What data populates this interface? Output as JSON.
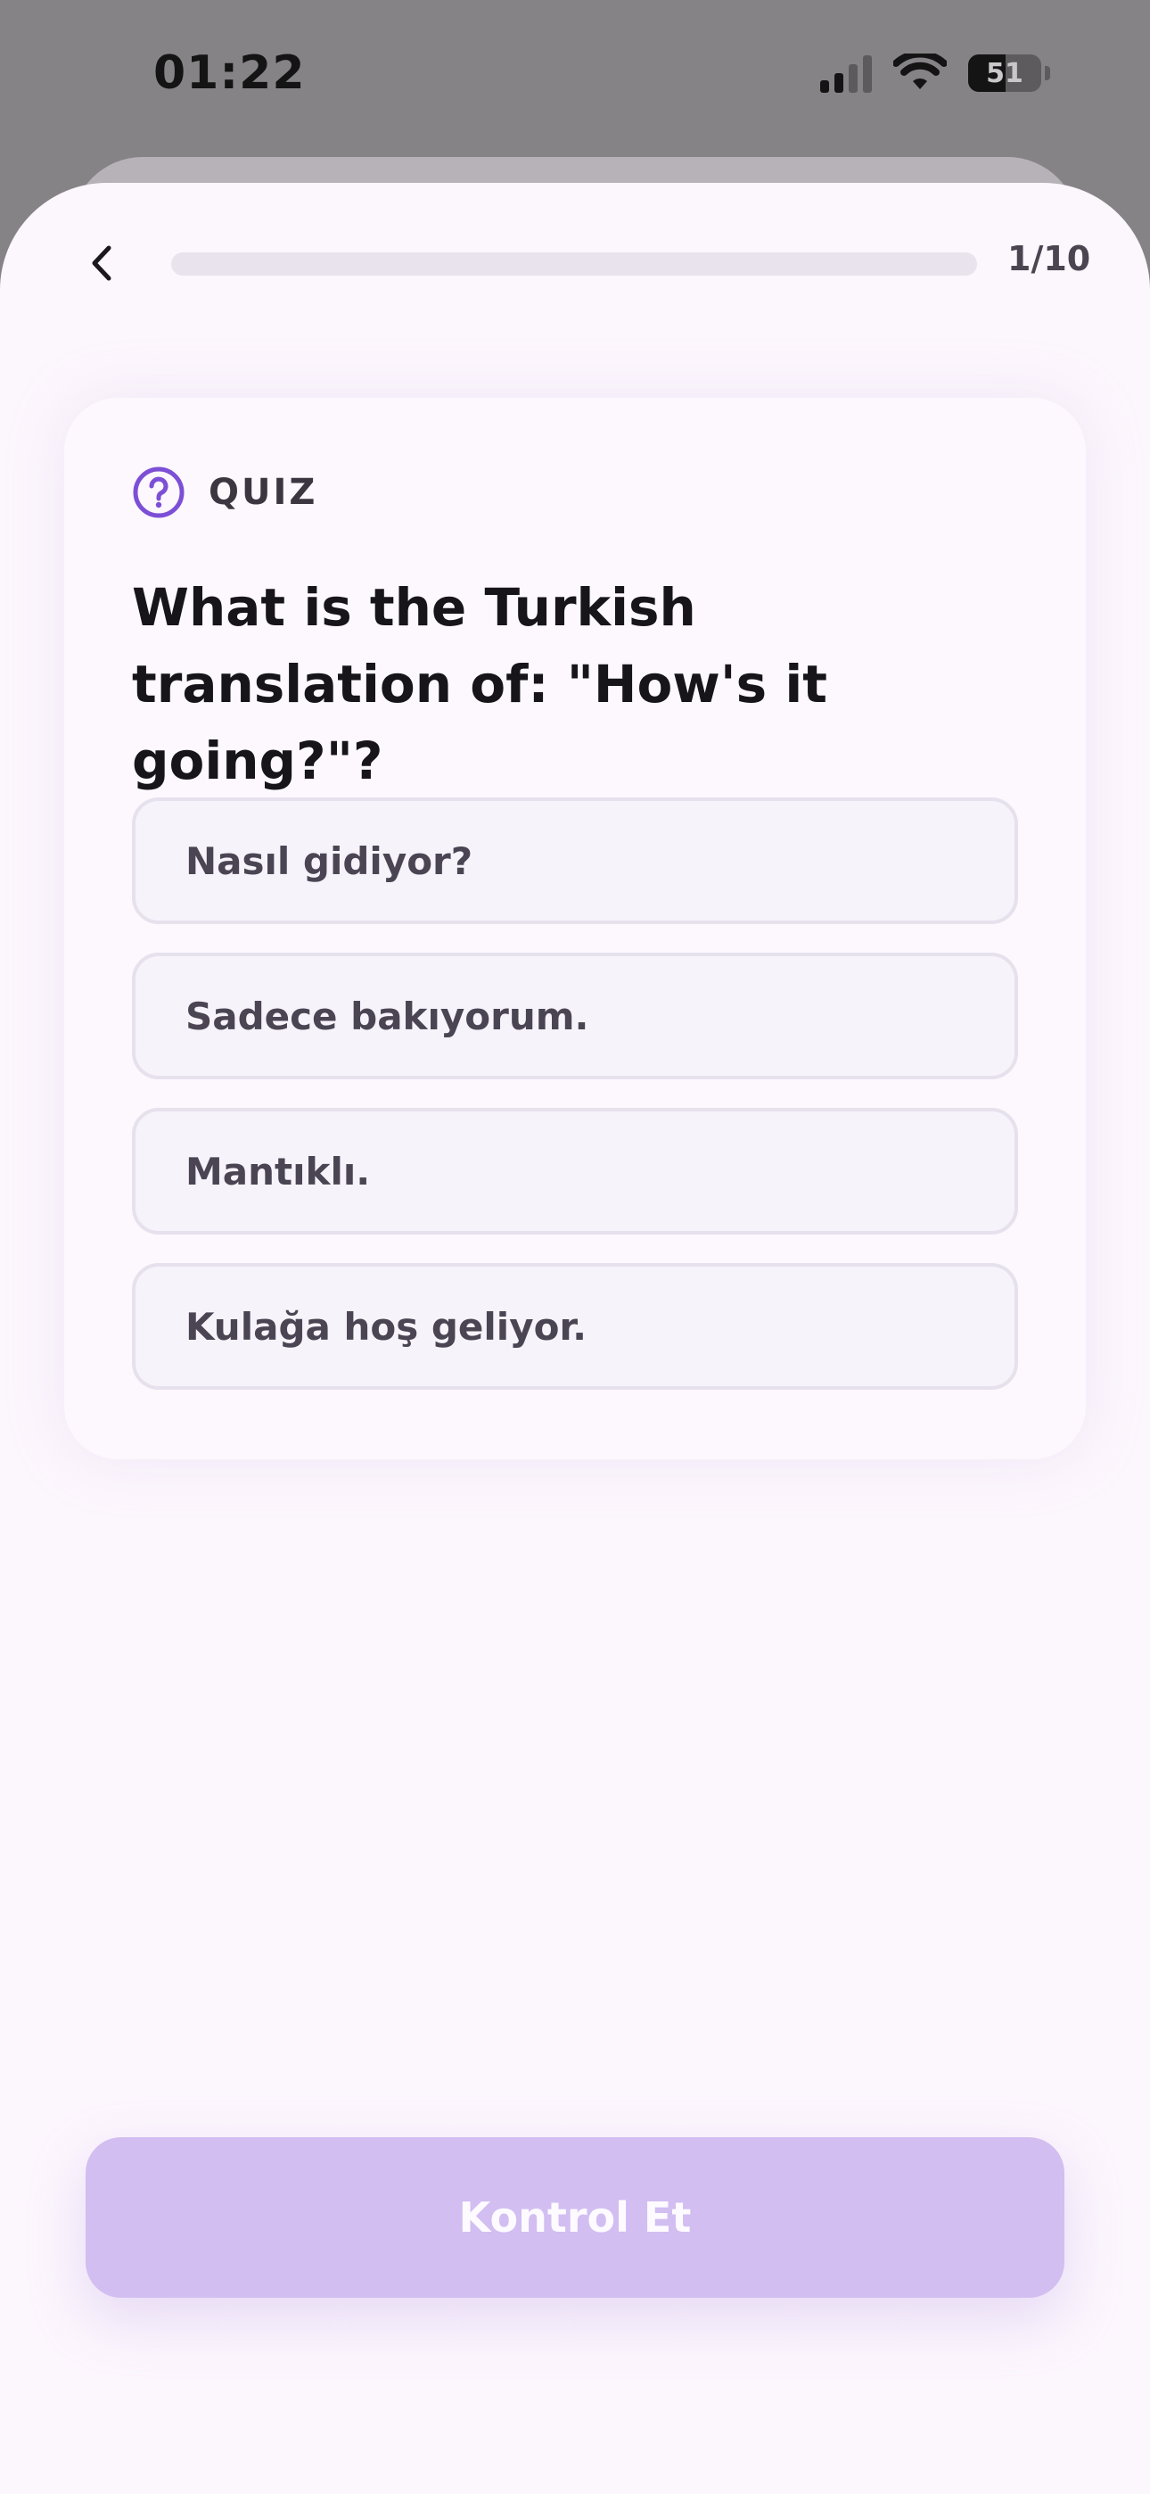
{
  "status_bar": {
    "time": "01:22",
    "battery": "51",
    "battery_level": 0.51
  },
  "nav": {
    "progress_text": "1/10",
    "progress_fraction": 0.0
  },
  "quiz": {
    "label": "QUIZ",
    "question": "What is the Turkish translation of: \"How's it going?\"?",
    "options": [
      "Nasıl gidiyor?",
      "Sadece bakıyorum.",
      "Mantıklı.",
      "Kulağa hoş geliyor."
    ]
  },
  "footer": {
    "check_label": "Kontrol Et"
  },
  "colors": {
    "accent": "#7c4fd6",
    "button_disabled": "#d2bef1",
    "sheet_background": "#fcf6fd"
  }
}
